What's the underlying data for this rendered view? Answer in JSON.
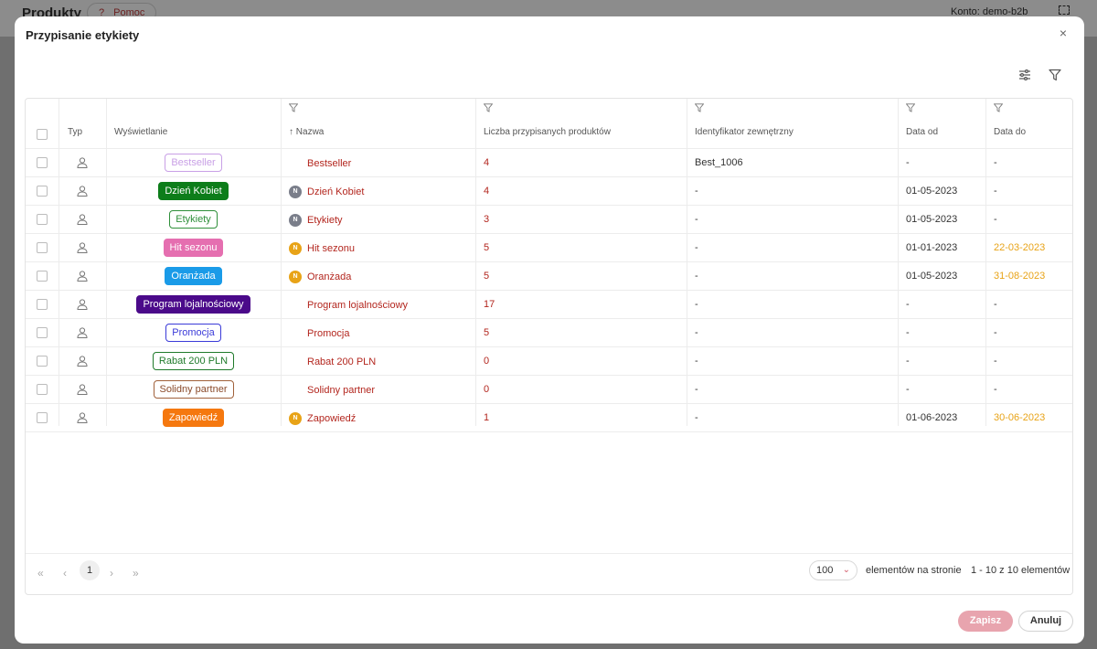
{
  "background": {
    "title": "Produkty",
    "help_label": "Pomoc",
    "help_icon": "?",
    "account": "Konto: demo-b2b"
  },
  "modal": {
    "title": "Przypisanie etykiety",
    "close": "×"
  },
  "columns": {
    "typ": "Typ",
    "display": "Wyświetlanie",
    "name": "Nazwa",
    "name_sort": "↑",
    "count": "Liczba przypisanych produktów",
    "external_id": "Identyfikator zewnętrzny",
    "date_from": "Data od",
    "date_to": "Data do"
  },
  "rows": [
    {
      "badge": "Bestseller",
      "badge_style": {
        "bg": "#ffffff",
        "fg": "#c9a0e6",
        "border": "#c9a0e6"
      },
      "name_icon": "",
      "name_icon_color": "",
      "name": "Bestseller",
      "count": "4",
      "ext": "Best_1006",
      "from": "-",
      "to": "-",
      "to_warn": false
    },
    {
      "badge": "Dzień Kobiet",
      "badge_style": {
        "bg": "#0d7d1a",
        "fg": "#ffffff",
        "border": "#0d7d1a"
      },
      "name_icon": "N",
      "name_icon_color": "#7a7e8a",
      "name": "Dzień Kobiet",
      "count": "4",
      "ext": "-",
      "from": "01-05-2023",
      "to": "-",
      "to_warn": false
    },
    {
      "badge": "Etykiety",
      "badge_style": {
        "bg": "#ffffff",
        "fg": "#2f8f3a",
        "border": "#2f8f3a"
      },
      "name_icon": "N",
      "name_icon_color": "#7a7e8a",
      "name": "Etykiety",
      "count": "3",
      "ext": "-",
      "from": "01-05-2023",
      "to": "-",
      "to_warn": false
    },
    {
      "badge": "Hit sezonu",
      "badge_style": {
        "bg": "#e56fb0",
        "fg": "#ffffff",
        "border": "#e56fb0"
      },
      "name_icon": "N",
      "name_icon_color": "#e8a317",
      "name": "Hit sezonu",
      "count": "5",
      "ext": "-",
      "from": "01-01-2023",
      "to": "22-03-2023",
      "to_warn": true
    },
    {
      "badge": "Oranżada",
      "badge_style": {
        "bg": "#1a9be8",
        "fg": "#ffffff",
        "border": "#1a9be8"
      },
      "name_icon": "N",
      "name_icon_color": "#e8a317",
      "name": "Oranżada",
      "count": "5",
      "ext": "-",
      "from": "01-05-2023",
      "to": "31-08-2023",
      "to_warn": true
    },
    {
      "badge": "Program lojalnościowy",
      "badge_style": {
        "bg": "#4b0a8a",
        "fg": "#ffffff",
        "border": "#4b0a8a"
      },
      "name_icon": "",
      "name_icon_color": "",
      "name": "Program lojalnościowy",
      "count": "17",
      "ext": "-",
      "from": "-",
      "to": "-",
      "to_warn": false
    },
    {
      "badge": "Promocja",
      "badge_style": {
        "bg": "#ffffff",
        "fg": "#3a3ad8",
        "border": "#3a3ad8"
      },
      "name_icon": "",
      "name_icon_color": "",
      "name": "Promocja",
      "count": "5",
      "ext": "-",
      "from": "-",
      "to": "-",
      "to_warn": false
    },
    {
      "badge": "Rabat 200 PLN",
      "badge_style": {
        "bg": "#ffffff",
        "fg": "#1f7a2a",
        "border": "#1f7a2a"
      },
      "name_icon": "",
      "name_icon_color": "",
      "name": "Rabat 200 PLN",
      "count": "0",
      "ext": "-",
      "from": "-",
      "to": "-",
      "to_warn": false
    },
    {
      "badge": "Solidny partner",
      "badge_style": {
        "bg": "#ffffff",
        "fg": "#8a4a2a",
        "border": "#a0603a"
      },
      "name_icon": "",
      "name_icon_color": "",
      "name": "Solidny partner",
      "count": "0",
      "ext": "-",
      "from": "-",
      "to": "-",
      "to_warn": false
    },
    {
      "badge": "Zapowiedź",
      "badge_style": {
        "bg": "#f5780f",
        "fg": "#ffffff",
        "border": "#f5780f"
      },
      "name_icon": "N",
      "name_icon_color": "#e8a317",
      "name": "Zapowiedź",
      "count": "1",
      "ext": "-",
      "from": "01-06-2023",
      "to": "30-06-2023",
      "to_warn": true
    }
  ],
  "pager": {
    "first": "«",
    "prev": "‹",
    "current": "1",
    "next": "›",
    "last": "»",
    "page_size": "100",
    "page_size_chevron": "⌄",
    "per_page_label": "elementów na stronie",
    "range": "1 - 10 z 10 elementów"
  },
  "buttons": {
    "save": "Zapisz",
    "cancel": "Anuluj"
  },
  "colors": {
    "accent": "#b3261e",
    "warn": "#e8a317",
    "save_bg": "#e8a4ae"
  },
  "icons": [
    "close-icon",
    "settings-sliders-icon",
    "filter-icon",
    "user-icon",
    "first-page-icon",
    "prev-page-icon",
    "next-page-icon",
    "last-page-icon",
    "chevron-down-icon"
  ]
}
